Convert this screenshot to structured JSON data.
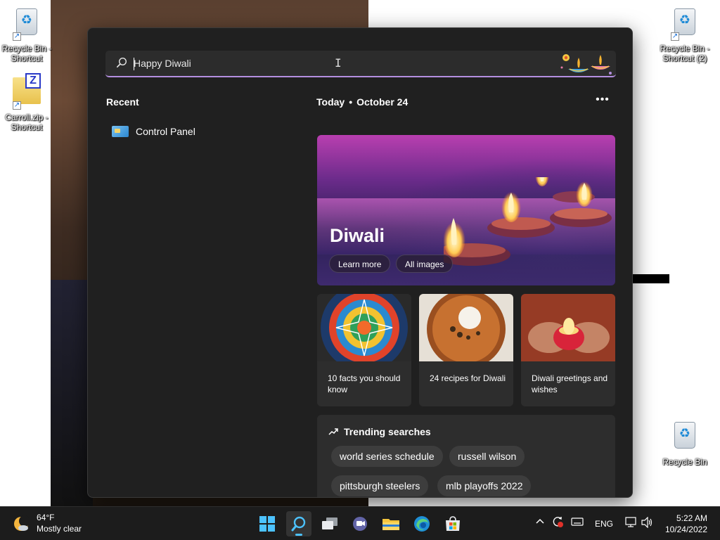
{
  "desktop": {
    "icons": [
      {
        "label": "Recycle Bin - Shortcut"
      },
      {
        "label": "Carroll.zip - Shortcut"
      },
      {
        "label": "Recycle Bin - Shortcut (2)"
      },
      {
        "label": "Recycle Bin"
      }
    ]
  },
  "search": {
    "query": "Happy Diwali",
    "icon": "search-icon"
  },
  "recent": {
    "title": "Recent",
    "items": [
      {
        "label": "Control Panel",
        "icon": "control-panel-icon"
      }
    ]
  },
  "today": {
    "label": "Today",
    "date": "October 24",
    "more_icon": "more-icon"
  },
  "hero": {
    "title": "Diwali",
    "learn_more": "Learn more",
    "all_images": "All images"
  },
  "cards": [
    {
      "caption": "10 facts you should know"
    },
    {
      "caption": "24 recipes for Diwali"
    },
    {
      "caption": "Diwali greetings and wishes"
    }
  ],
  "trending": {
    "title": "Trending searches",
    "chips": [
      "world series schedule",
      "russell wilson",
      "pittsburgh steelers",
      "mlb playoffs 2022"
    ]
  },
  "taskbar": {
    "weather_temp": "64°F",
    "weather_cond": "Mostly clear",
    "lang": "ENG",
    "time": "5:22 AM",
    "date": "10/24/2022",
    "accent": "#4cc2ff"
  }
}
